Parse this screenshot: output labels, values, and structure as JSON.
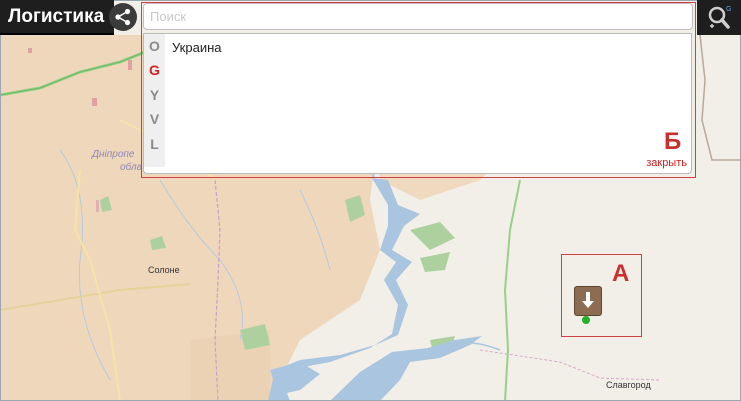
{
  "header": {
    "title": "Логистика",
    "share_icon": "share-icon",
    "zoom_icon": "zoom-search-icon"
  },
  "search": {
    "placeholder": "Поиск",
    "value": ""
  },
  "dropdown": {
    "letters": [
      "O",
      "G",
      "Y",
      "V",
      "L"
    ],
    "active_letter": "G",
    "suggestions": [
      "Украина"
    ],
    "close_label": "закрыть"
  },
  "annotations": {
    "a_label": "А",
    "b_label": "Б"
  },
  "map": {
    "places": {
      "solone": "Солоне",
      "slavgorod": "Славгород"
    },
    "region_line1": "Дніпропе",
    "region_line2": "обла",
    "marker_icon": "download-arrow-icon",
    "colors": {
      "land": "#f2efe9",
      "farmland": "#efd7bb",
      "water": "#aac5df",
      "forest": "#add19e",
      "border_accent": "#d32020"
    }
  }
}
